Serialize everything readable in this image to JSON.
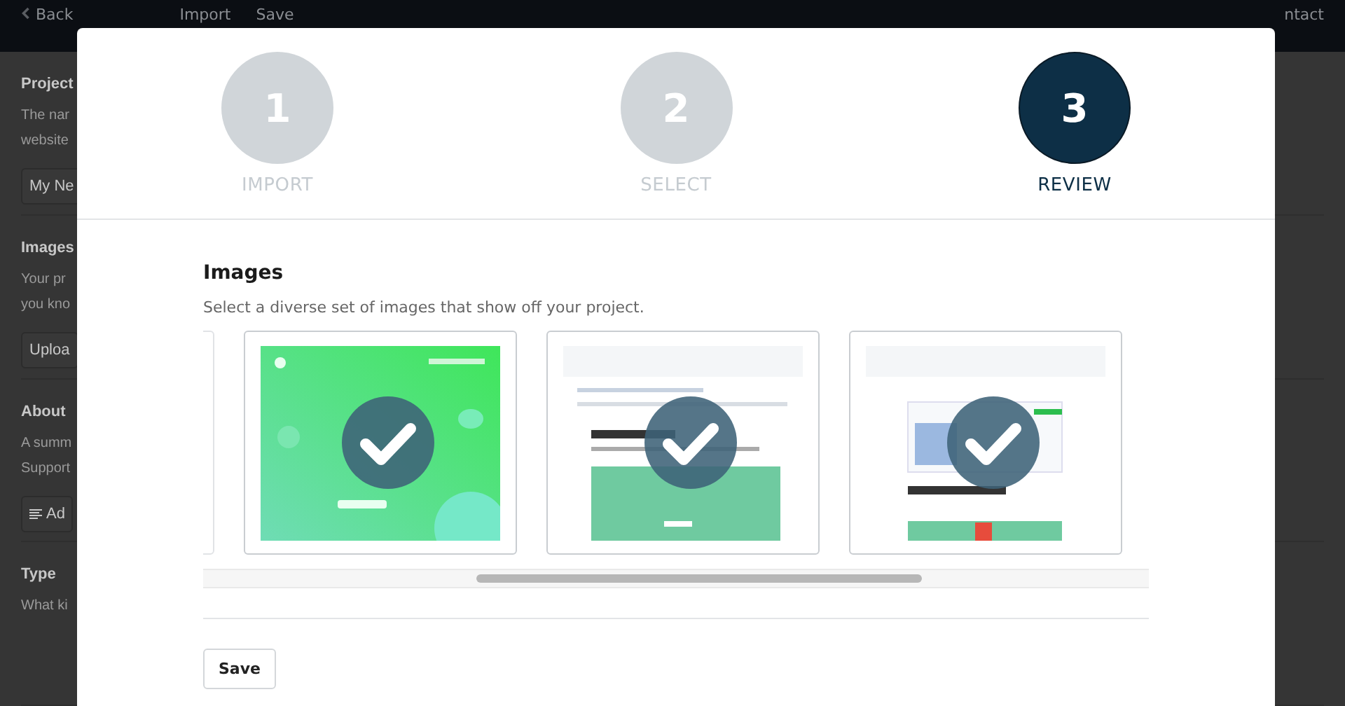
{
  "background_page": {
    "top_bar": {
      "back": "Back",
      "import": "Import",
      "save": "Save",
      "contact": "ntact"
    },
    "sections": [
      {
        "title": "Project",
        "description": [
          "The nar",
          "website"
        ],
        "control": {
          "kind": "field",
          "text": "My Ne"
        }
      },
      {
        "title": "Images",
        "description": [
          "Your pr",
          "you kno"
        ],
        "control": {
          "kind": "button",
          "text": "Uploa"
        }
      },
      {
        "title": "About",
        "description": [
          "A summ",
          "Support"
        ],
        "control": {
          "kind": "icon-button",
          "text": "Ad"
        }
      },
      {
        "title": "Type",
        "description": [
          "What ki"
        ]
      }
    ]
  },
  "dialog": {
    "steps": [
      {
        "number": "1",
        "label": "IMPORT",
        "selected": false
      },
      {
        "number": "2",
        "label": "SELECT",
        "selected": false
      },
      {
        "number": "3",
        "label": "REVIEW",
        "selected": true
      }
    ],
    "title": "Images",
    "description": "Select a diverse set of images that show off your project.",
    "images": [
      {
        "kind": "partial",
        "selected": false
      },
      {
        "kind": "landing",
        "selected": true
      },
      {
        "kind": "repo",
        "selected": true
      },
      {
        "kind": "repo-list",
        "selected": true
      }
    ],
    "save_button": "Save"
  }
}
